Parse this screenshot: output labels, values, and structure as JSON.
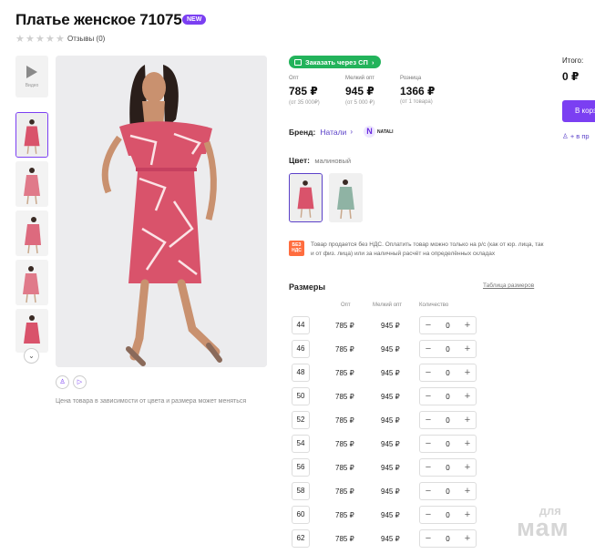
{
  "product": {
    "title": "Платье женское 71075",
    "badge": "NEW",
    "reviews": "Отзывы (0)"
  },
  "gallery": {
    "video_label": "Видео",
    "price_note": "Цена товара в зависимости от цвета и размера может меняться"
  },
  "order_sp": "Заказать через СП",
  "prices": [
    {
      "label": "Опт",
      "value": "785 ₽",
      "sub": "(от 35 000₽)"
    },
    {
      "label": "Мелкий опт",
      "value": "945 ₽",
      "sub": "(от 5 000 ₽)"
    },
    {
      "label": "Розница",
      "value": "1366 ₽",
      "sub": "(от 1 товара)"
    }
  ],
  "brand": {
    "label": "Бренд:",
    "name": "Натали",
    "logo_text": "NATALI"
  },
  "color": {
    "label": "Цвет:",
    "value": "малиновый"
  },
  "vat": {
    "icon_text": "БЕЗ НДС",
    "text": "Товар продается без НДС. Оплатить товар можно только на р/с (как от юр. лица, так и от физ. лица) или за наличный расчёт на определённых складах"
  },
  "sizes": {
    "title": "Размеры",
    "table_link": "Таблица размеров",
    "headers": {
      "opt": "Опт",
      "small_opt": "Мелкий опт",
      "qty": "Количество"
    },
    "rows": [
      {
        "size": "44",
        "opt": "785 ₽",
        "small_opt": "945 ₽",
        "qty": "0"
      },
      {
        "size": "46",
        "opt": "785 ₽",
        "small_opt": "945 ₽",
        "qty": "0"
      },
      {
        "size": "48",
        "opt": "785 ₽",
        "small_opt": "945 ₽",
        "qty": "0"
      },
      {
        "size": "50",
        "opt": "785 ₽",
        "small_opt": "945 ₽",
        "qty": "0"
      },
      {
        "size": "52",
        "opt": "785 ₽",
        "small_opt": "945 ₽",
        "qty": "0"
      },
      {
        "size": "54",
        "opt": "785 ₽",
        "small_opt": "945 ₽",
        "qty": "0"
      },
      {
        "size": "56",
        "opt": "785 ₽",
        "small_opt": "945 ₽",
        "qty": "0"
      },
      {
        "size": "58",
        "opt": "785 ₽",
        "small_opt": "945 ₽",
        "qty": "0"
      },
      {
        "size": "60",
        "opt": "785 ₽",
        "small_opt": "945 ₽",
        "qty": "0"
      },
      {
        "size": "62",
        "opt": "785 ₽",
        "small_opt": "945 ₽",
        "qty": "0"
      }
    ]
  },
  "summary": {
    "total_label": "Итого:",
    "total_value": "0 ₽",
    "cart_button": "В корзину",
    "favorite": "+ в пр"
  },
  "watermark": {
    "line1": "для",
    "line2": "мам"
  },
  "colors": {
    "accent": "#7b3ff2",
    "green": "#23b35b",
    "dress": "#d9536b",
    "vat": "#ff6d3f"
  }
}
